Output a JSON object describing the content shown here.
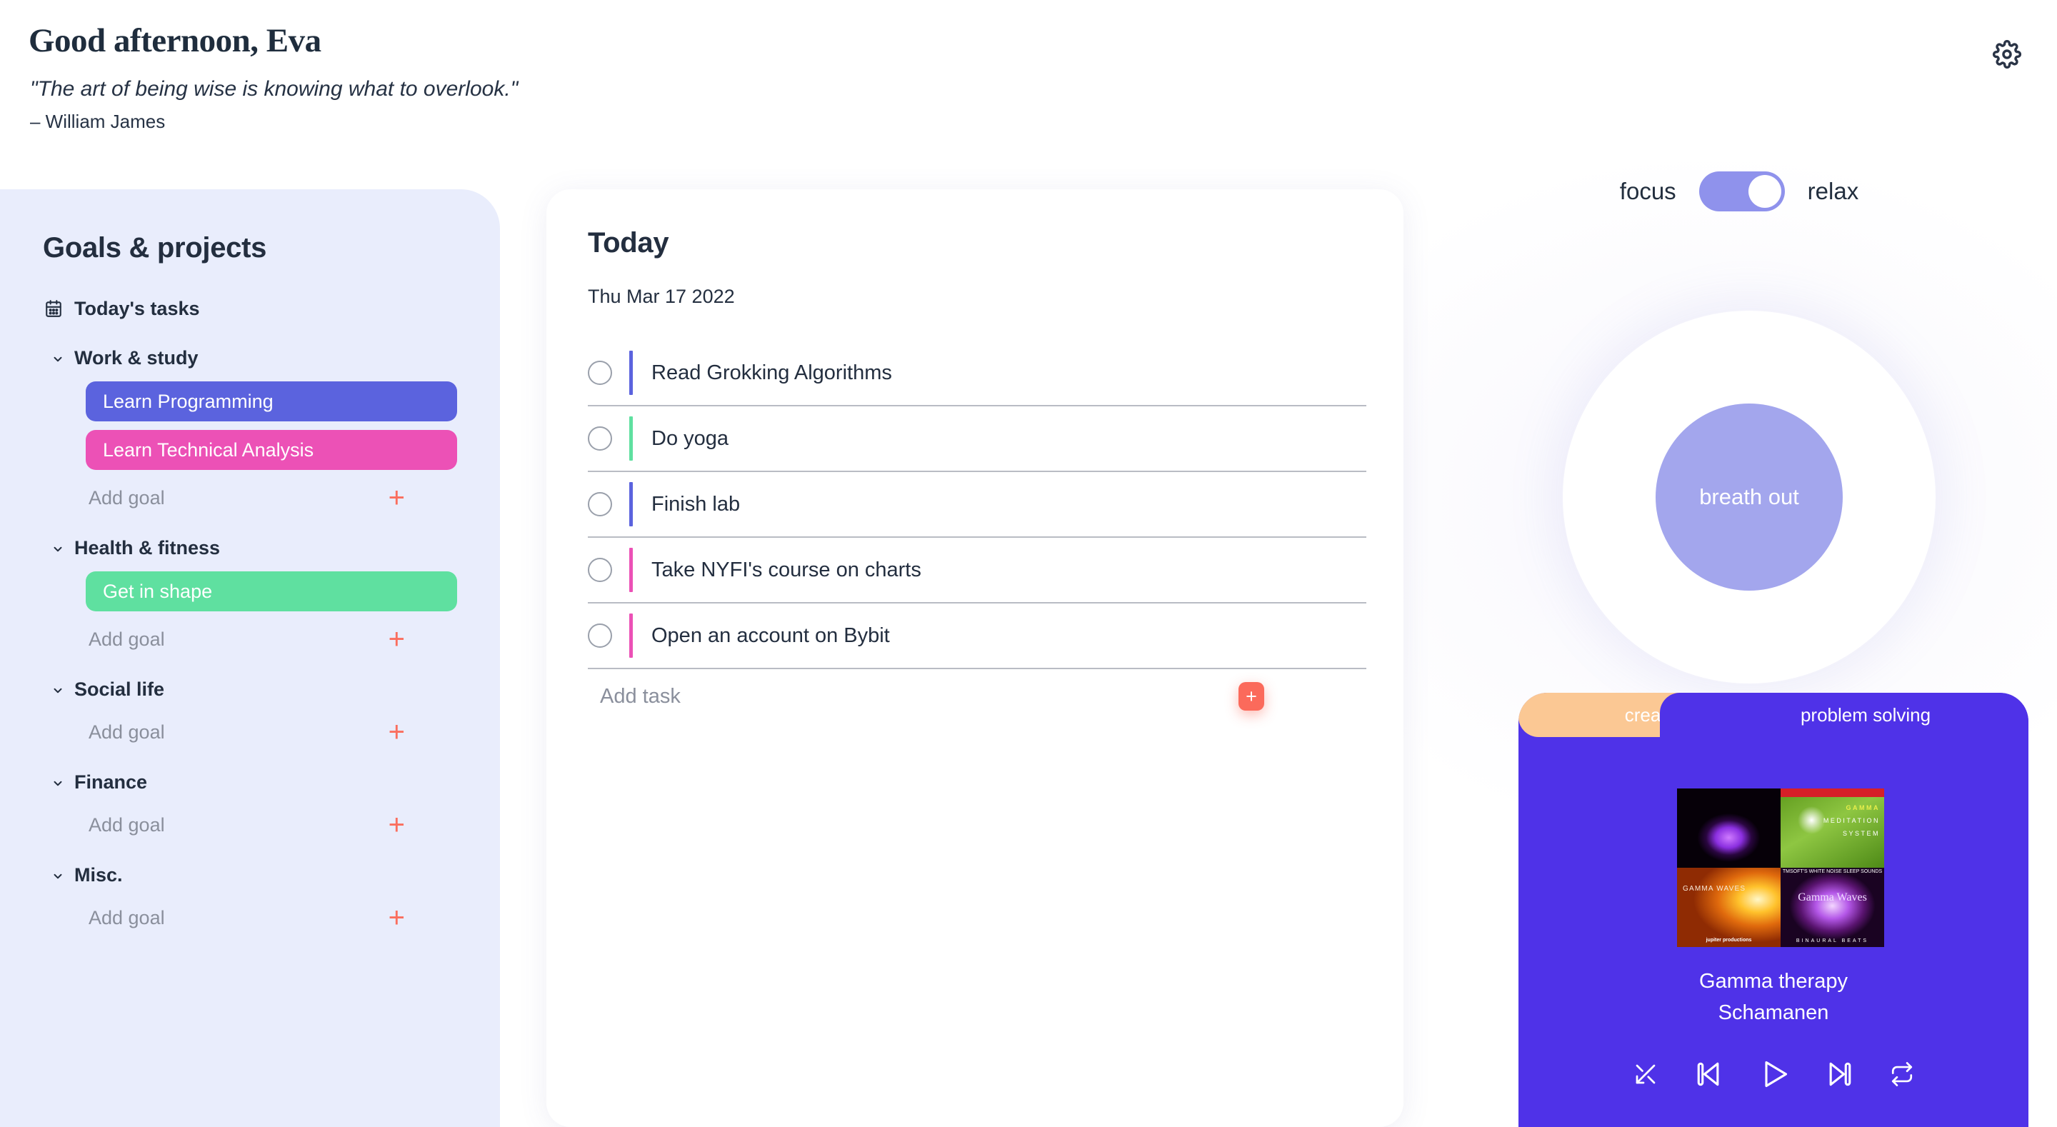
{
  "header": {
    "greeting": "Good afternoon, Eva",
    "quote": "\"The art of being wise is knowing what to overlook.\"",
    "quote_author": "– William James",
    "settings_icon": "gear-icon"
  },
  "sidebar": {
    "title": "Goals & projects",
    "today_tasks_label": "Today's tasks",
    "today_icon": "calendar-icon",
    "add_goal_label": "Add goal",
    "add_icon": "plus-icon",
    "groups": [
      {
        "label": "Work & study",
        "goals": [
          {
            "label": "Learn Programming",
            "color": "#5b63de"
          },
          {
            "label": "Learn Technical Analysis",
            "color": "#ec51b6"
          }
        ]
      },
      {
        "label": "Health & fitness",
        "goals": [
          {
            "label": "Get in shape",
            "color": "#5fe0a0"
          }
        ]
      },
      {
        "label": "Social life",
        "goals": []
      },
      {
        "label": "Finance",
        "goals": []
      },
      {
        "label": "Misc.",
        "goals": []
      }
    ]
  },
  "today": {
    "title": "Today",
    "date": "Thu Mar 17 2022",
    "add_task_label": "Add task",
    "add_task_button": "+",
    "tasks": [
      {
        "label": "Read Grokking Algorithms",
        "color": "#5b63de",
        "checked": false
      },
      {
        "label": "Do yoga",
        "color": "#5fe0a0",
        "checked": false
      },
      {
        "label": "Finish lab",
        "color": "#5b63de",
        "checked": false
      },
      {
        "label": "Take NYFI's course on charts",
        "color": "#ec51b6",
        "checked": false
      },
      {
        "label": "Open an account on Bybit",
        "color": "#ec51b6",
        "checked": false
      }
    ]
  },
  "mode": {
    "left_label": "focus",
    "right_label": "relax",
    "state": "relax",
    "accent": "#8f92ec"
  },
  "breath": {
    "label": "breath out",
    "inner_color": "#a3a6ed",
    "outer_color": "#ffffff"
  },
  "player": {
    "tabs": [
      {
        "label": "creativity",
        "active": false,
        "color": "#fbc894"
      },
      {
        "label": "problem solving",
        "active": true,
        "color": "#4f32e8"
      }
    ],
    "track_title": "Gamma therapy",
    "track_artist": "Schamanen",
    "panel_color": "#4f32e8",
    "album_art": [
      {
        "name": "album-art-purple-orb",
        "caption": ""
      },
      {
        "name": "album-art-gamma-meditation-system",
        "caption": "GAMMA MEDITATION SYSTEM",
        "line1": "GAMMA",
        "line2": "MEDITATION",
        "line3": "SYSTEM"
      },
      {
        "name": "album-art-gamma-waves-jupiter",
        "caption": "GAMMA WAVES",
        "sub": "jupiter productions"
      },
      {
        "name": "album-art-gamma-waves-binaural",
        "caption": "Gamma Waves",
        "sub": "BINAURAL BEATS",
        "top": "TMSOFT'S WHITE NOISE SLEEP SOUNDS"
      }
    ],
    "controls": [
      {
        "name": "shuffle-icon",
        "label": "shuffle"
      },
      {
        "name": "previous-track-icon",
        "label": "previous"
      },
      {
        "name": "play-icon",
        "label": "play"
      },
      {
        "name": "next-track-icon",
        "label": "next"
      },
      {
        "name": "repeat-icon",
        "label": "repeat"
      }
    ]
  }
}
